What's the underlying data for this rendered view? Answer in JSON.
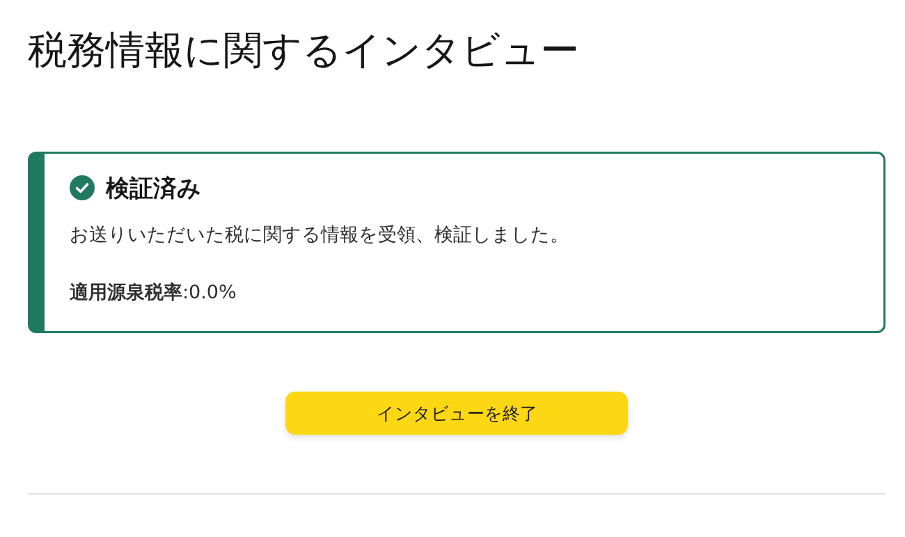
{
  "page": {
    "title": "税務情報に関するインタビュー"
  },
  "status_card": {
    "kind": "success",
    "title": "検証済み",
    "message": "お送りいただいた税に関する情報を受領、検証しました。",
    "rate": "**適用源泉税率**:0.0%"
  },
  "buttons": [
    {
      "label": "インタビューを終了"
    }
  ]
}
